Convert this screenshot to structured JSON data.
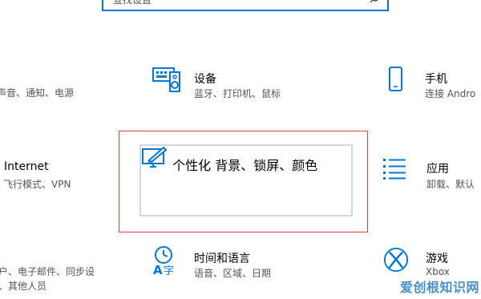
{
  "search": {
    "placeholder": "查找设置"
  },
  "tiles": {
    "system": {
      "sub": "声音、通知、电源"
    },
    "devices": {
      "title": "设备",
      "sub": "蓝牙、打印机、鼠标"
    },
    "phone": {
      "title": "手机",
      "sub": "连接 Andro"
    },
    "network": {
      "title": "Internet",
      "sub": "飞行模式、VPN"
    },
    "personalization": {
      "title": "个性化",
      "sub": "背景、锁屏、颜色"
    },
    "apps": {
      "title": "应用",
      "sub": "卸载、默认"
    },
    "accounts": {
      "sub1": "户、电子邮件、同步设",
      "sub2": "、其他人员"
    },
    "time_language": {
      "title": "时间和语言",
      "sub": "语音、区域、日期"
    },
    "gaming": {
      "title": "游戏",
      "sub": "Xbox"
    }
  },
  "accent_color": "#0078d7",
  "highlight_color": "#e2453c",
  "watermark": "爱创根知识网"
}
